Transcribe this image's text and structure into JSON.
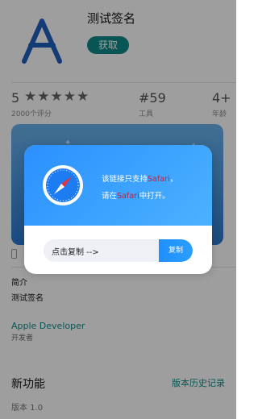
{
  "app": {
    "name": "测试签名",
    "get_label": "获取",
    "icon_name": "letter-a-icon"
  },
  "info_bar": {
    "rating_value": "5",
    "stars": "★★★★★",
    "rating_count_label": "2000个评分",
    "rank_value": "#59",
    "rank_label": "工具",
    "age_value": "4+",
    "age_label": "年龄"
  },
  "device": {
    "icon_name": "iphone-icon"
  },
  "intro": {
    "title": "简介",
    "text": "测试签名"
  },
  "developer": {
    "name": "Apple Developer",
    "role": "开发者"
  },
  "whats_new": {
    "title": "新功能",
    "version_history_label": "版本历史记录",
    "version": "版本 1.0"
  },
  "modal": {
    "icon_name": "safari-compass-icon",
    "line1_prefix": "该链接只支持",
    "line1_highlight": "Safari",
    "line1_suffix": "，",
    "line2_prefix": "请在",
    "line2_highlight": "Safari",
    "line2_suffix": "中打开。",
    "copy_hint": "点击复制 -->",
    "copy_button_label": "复制"
  },
  "colors": {
    "accent": "#0f8a8a",
    "modal_blue": "#2b90ff",
    "highlight_red": "#c81e3a"
  }
}
